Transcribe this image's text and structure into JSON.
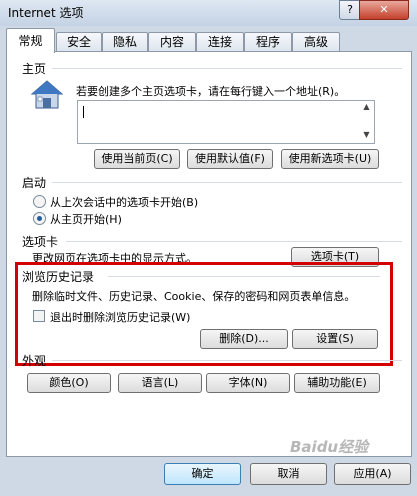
{
  "window": {
    "title": "Internet 选项",
    "help": "?",
    "close": "✕"
  },
  "tabs": [
    {
      "label": "常规"
    },
    {
      "label": "安全"
    },
    {
      "label": "隐私"
    },
    {
      "label": "内容"
    },
    {
      "label": "连接"
    },
    {
      "label": "程序"
    },
    {
      "label": "高级"
    }
  ],
  "homepage": {
    "group": "主页",
    "description": "若要创建多个主页选项卡，请在每行键入一个地址(R)。",
    "url_value": "",
    "buttons": [
      "使用当前页(C)",
      "使用默认值(F)",
      "使用新选项卡(U)"
    ]
  },
  "startup": {
    "group": "启动",
    "options": [
      "从上次会话中的选项卡开始(B)",
      "从主页开始(H)"
    ],
    "selected": "从主页开始(H)"
  },
  "tabs_section": {
    "group": "选项卡",
    "description": "更改网页在选项卡中的显示方式。",
    "button": "选项卡(T)"
  },
  "history": {
    "group": "浏览历史记录",
    "description": "删除临时文件、历史记录、Cookie、保存的密码和网页表单信息。",
    "checkbox_label": "退出时删除浏览历史记录(W)",
    "checkbox_checked": false,
    "delete_button": "删除(D)...",
    "settings_button": "设置(S)"
  },
  "appearance": {
    "group": "外观",
    "buttons": [
      "颜色(O)",
      "语言(L)",
      "字体(N)",
      "辅助功能(E)"
    ]
  },
  "footer": {
    "ok": "确定",
    "cancel": "取消",
    "apply": "应用(A)"
  },
  "watermark": "Baidu经验",
  "colors": {
    "highlight_box": "#d40000",
    "title_gradient_top": "#dfe8f3",
    "panel": "#ffffff"
  }
}
